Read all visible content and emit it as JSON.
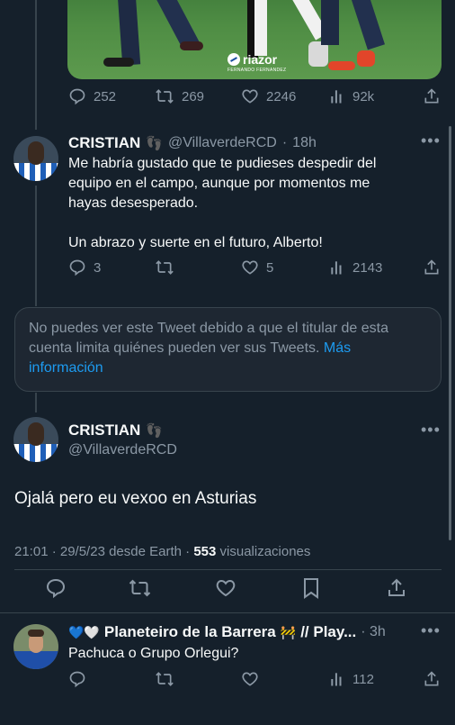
{
  "media": {
    "watermark_brand": "riazor",
    "watermark_credit": "FERNANDO FERNANDEZ"
  },
  "tweet1_actions": {
    "replies": "252",
    "retweets": "269",
    "likes": "2246",
    "views": "92k"
  },
  "reply1": {
    "name": "CRISTIAN",
    "emoji": "👣",
    "handle": "@VillaverdeRCD",
    "time": "18h",
    "text_p1": "Me habría gustado que te pudieses despedir del equipo en el campo, aunque por momentos me hayas desesperado.",
    "text_p2": "Un abrazo y suerte en el futuro, Alberto!",
    "replies": "3",
    "likes": "5",
    "views": "2143"
  },
  "restricted": {
    "text": "No puedes ver este Tweet debido a que el titular de esta cuenta limita quiénes pueden ver sus Tweets.",
    "link": "Más información"
  },
  "main_tweet": {
    "name": "CRISTIAN",
    "emoji": "👣",
    "handle": "@VillaverdeRCD",
    "text": "Ojalá pero eu vexoo en Asturias",
    "meta": "21:01 · 29/5/23 desde Earth ·",
    "views_count": "553",
    "views_label": "visualizaciones"
  },
  "reply2": {
    "hearts": "💙🤍",
    "name": "Planeteiro de la Barrera",
    "emoji": "🚧",
    "name_suffix": "// Play...",
    "time": "· 3h",
    "text": "Pachuca o Grupo Orlegui?",
    "views": "112"
  },
  "colors": {
    "background": "#15202b",
    "text": "#f7f9f9",
    "muted": "#8b98a5",
    "link": "#1d9bf0",
    "border": "#38444d"
  },
  "icons": [
    "reply-icon",
    "retweet-icon",
    "like-icon",
    "views-icon",
    "share-icon",
    "bookmark-icon",
    "more-icon"
  ]
}
